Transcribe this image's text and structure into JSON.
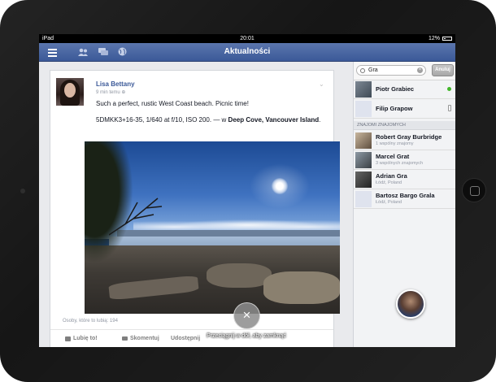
{
  "statusbar": {
    "device": "iPad",
    "time": "20:01",
    "battery": "12%"
  },
  "navbar": {
    "title": "Aktualności"
  },
  "post": {
    "author": "Lisa Bettany",
    "time": "9 min temu",
    "text": "Such a perfect, rustic West Coast beach. Picnic time!",
    "camera_info": "5DMKK3+16-35, 1/640 at f/10, ISO 200. — w ",
    "location": "Deep Cove, Vancouver Island",
    "location_suffix": ".",
    "likes_text": "Osoby, które to lubią: 194",
    "like_label": "Lubię to!",
    "comment_label": "Skomentuj",
    "share_label": "Udostępnij"
  },
  "overlay": {
    "close_symbol": "×",
    "hint": "Przeciągnij w dół, aby zamknąć"
  },
  "sidebar": {
    "search_value": "Gra",
    "cancel_label": "Anuluj",
    "top_contacts": [
      {
        "name": "Piotr Grabiec",
        "status": "online"
      },
      {
        "name": "Filip Grapow",
        "status": "mobile"
      }
    ],
    "section_header": "ZNAJOMI ZNAJOMYCH",
    "fof_contacts": [
      {
        "name": "Robert Gray Burbridge",
        "sub": "1 wspólny znajomy"
      },
      {
        "name": "Marcel Grat",
        "sub": "3 wspólnych znajomych"
      },
      {
        "name": "Adrian Gra",
        "sub": "Łódź, Poland"
      },
      {
        "name": "Bartosz Bargo Grala",
        "sub": "Łódź, Poland"
      }
    ]
  },
  "colors": {
    "nav": "#3b5998",
    "online": "#42b72a"
  }
}
